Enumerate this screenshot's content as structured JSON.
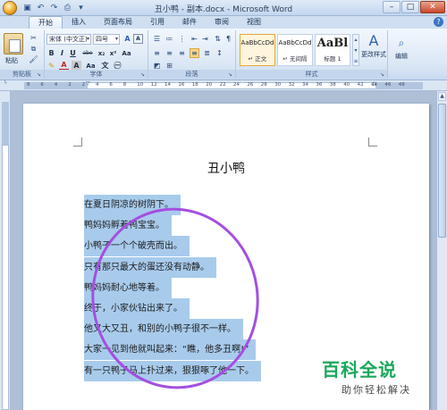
{
  "window": {
    "title": "丑小鸭 - 副本.docx - Microsoft Word",
    "controls": {
      "minimize": "–",
      "maximize": "□",
      "close": "✕"
    }
  },
  "quick_access": [
    "save-icon",
    "undo-icon",
    "redo-icon",
    "print-icon",
    "customize-icon"
  ],
  "tabs": [
    {
      "label": "开始",
      "active": true
    },
    {
      "label": "插入",
      "active": false
    },
    {
      "label": "页面布局",
      "active": false
    },
    {
      "label": "引用",
      "active": false
    },
    {
      "label": "邮件",
      "active": false
    },
    {
      "label": "审阅",
      "active": false
    },
    {
      "label": "视图",
      "active": false
    }
  ],
  "ribbon": {
    "clipboard": {
      "paste_label": "粘贴",
      "group_label": "剪贴板"
    },
    "font": {
      "font_name": "宋体 (中文正)",
      "font_size": "四号",
      "group_label": "字体",
      "buttons": [
        "B",
        "I",
        "U",
        "abe",
        "x₂",
        "x²",
        "Aa",
        "A",
        "A"
      ]
    },
    "paragraph": {
      "group_label": "段落"
    },
    "styles": {
      "group_label": "样式",
      "items": [
        {
          "preview": "AaBbCcDd",
          "name": "↵ 正文",
          "active": true
        },
        {
          "preview": "AaBbCcDd",
          "name": "↵ 无间隔",
          "active": false
        },
        {
          "preview": "AaBl",
          "name": "标题 1",
          "active": false
        }
      ],
      "change_styles_label": "更改样式"
    },
    "editing": {
      "label": "编辑"
    }
  },
  "ruler": {
    "numbers": [
      "8",
      "6",
      "4",
      "2",
      "2",
      "4",
      "6",
      "8",
      "10",
      "12",
      "14",
      "16",
      "18",
      "20",
      "22",
      "24",
      "26",
      "28",
      "30",
      "32",
      "34",
      "36",
      "38",
      "40",
      "42",
      "44",
      "46",
      "48"
    ]
  },
  "document": {
    "title": "丑小鸭",
    "lines": [
      "在夏日阴凉的树阴下。",
      "鸭妈妈孵着鸭宝宝。",
      "小鸭子一个个破壳而出。",
      "只有那只最大的蛋还没有动静。",
      "鸭妈妈耐心地等着。",
      "终于，小家伙钻出来了。",
      "他又大又丑，和别的小鸭子很不一样。",
      "大家一见到他就叫起来：“瞧，他多丑啊!”",
      "有一只鸭子马上扑过来，狠狠啄了他一下。"
    ]
  },
  "annotation": {
    "color": "#a44fe0"
  },
  "watermark": {
    "title": "百科全说",
    "subtitle": "助你轻松解决"
  },
  "colors": {
    "selection": "#a8cbec",
    "ribbon_bg": "#dbe7f5",
    "watermark_green": "#19a85a"
  }
}
